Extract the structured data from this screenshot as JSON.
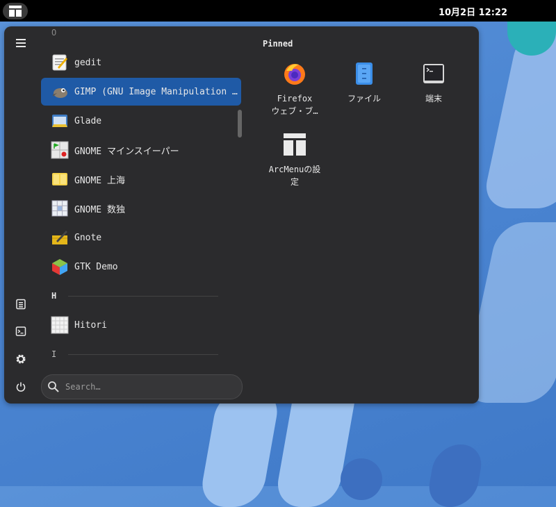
{
  "topbar": {
    "clock": "10月2日  12:22"
  },
  "sidebar": {
    "items": [
      "hamburger-menu",
      "documents",
      "terminal",
      "settings",
      "power"
    ]
  },
  "apps": {
    "section_o": "O",
    "items": [
      {
        "label": "gedit"
      },
      {
        "label": "GIMP (GNU Image Manipulation Program)"
      },
      {
        "label": "Glade"
      },
      {
        "label": "GNOME マインスイーパー"
      },
      {
        "label": "GNOME 上海"
      },
      {
        "label": "GNOME 数独"
      },
      {
        "label": "Gnote"
      },
      {
        "label": "GTK Demo"
      }
    ],
    "section_h": "H",
    "items_h": [
      {
        "label": "Hitori"
      }
    ],
    "section_i": "I"
  },
  "search": {
    "placeholder": "Search…"
  },
  "pinned": {
    "title": "Pinned",
    "items": [
      {
        "line1": "Firefox",
        "line2": "ウェブ・ブ…"
      },
      {
        "line1": "ファイル",
        "line2": ""
      },
      {
        "line1": "端末",
        "line2": ""
      },
      {
        "line1": "ArcMenuの設",
        "line2": "定"
      }
    ]
  },
  "colors": {
    "menu_bg": "#2b2b2d",
    "selected": "#1f5aa6",
    "topbar": "#000000"
  }
}
